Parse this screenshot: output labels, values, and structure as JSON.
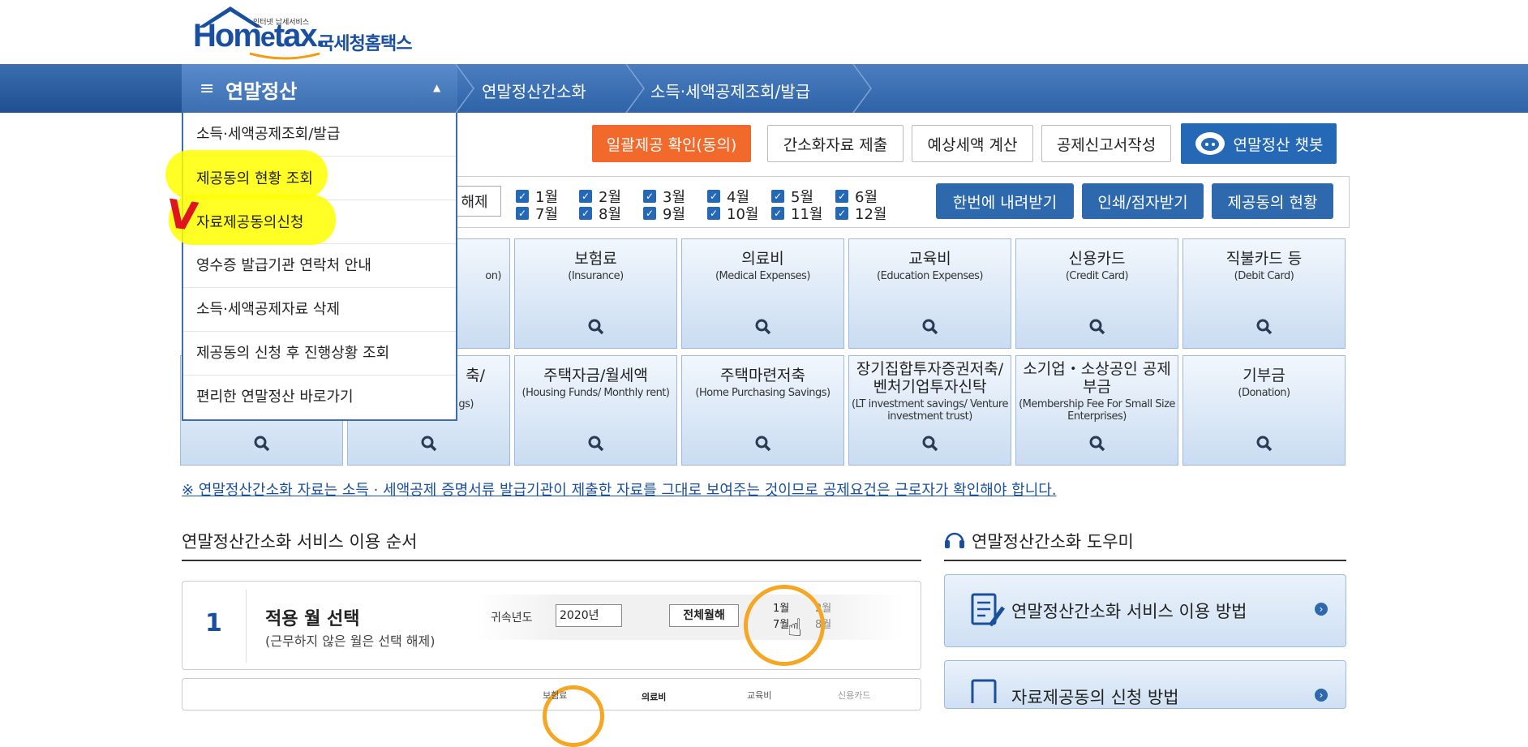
{
  "header": {
    "logo_small": "인터넷 납세서비스",
    "logo_home": "Hom",
    "logo_e": "e",
    "logo_tax": "tax.",
    "logo_kor": "국세청홈택스"
  },
  "nav": {
    "menu_title": "연말정산",
    "breadcrumb": [
      "연말정산간소화",
      "소득·세액공제조회/발급"
    ]
  },
  "dropdown": {
    "items": [
      "소득·세액공제조회/발급",
      "제공동의 현황 조회",
      "자료제공동의신청",
      "영수증 발급기관 연락처 안내",
      "소득·세액공제자료 삭제",
      "제공동의 신청 후 진행상황 조회",
      "편리한 연말정산 바로가기"
    ],
    "checkmark": "V"
  },
  "top_buttons": [
    "일괄제공 확인(동의)",
    "간소화자료 제출",
    "예상세액 계산",
    "공제신고서작성",
    "연말정산 챗봇"
  ],
  "month_bar": {
    "unselect": "해제",
    "months_row1": [
      "1월",
      "2월",
      "3월",
      "4월",
      "5월",
      "6월"
    ],
    "months_row2": [
      "7월",
      "8월",
      "9월",
      "10월",
      "11월",
      "12월"
    ],
    "buttons": [
      "한번에 내려받기",
      "인쇄/점자받기",
      "제공동의 현황"
    ]
  },
  "tiles_row1": [
    {
      "ko": "",
      "en": "on)"
    },
    {
      "ko": "보험료",
      "en": "(Insurance)"
    },
    {
      "ko": "의료비",
      "en": "(Medical Expenses)"
    },
    {
      "ko": "교육비",
      "en": "(Education Expenses)"
    },
    {
      "ko": "신용카드",
      "en": "(Credit Card)"
    },
    {
      "ko": "직불카드 등",
      "en": "(Debit Card)"
    }
  ],
  "tiles_row2": [
    {
      "ko": "",
      "en": ""
    },
    {
      "ko": "축/",
      "en": "gs)"
    },
    {
      "ko": "주택자금/월세액",
      "en": "(Housing Funds/ Monthly rent)"
    },
    {
      "ko": "주택마련저축",
      "en": "(Home Purchasing Savings)"
    },
    {
      "ko": "장기집합투자증권저축/ 벤처기업투자신탁",
      "en": "(LT investment savings/ Venture investment trust)"
    },
    {
      "ko": "소기업・소상공인 공제부금",
      "en": "(Membership Fee For Small Size Enterprises)"
    },
    {
      "ko": "기부금",
      "en": "(Donation)"
    }
  ],
  "notice": "※ 연말정산간소화 자료는 소득 · 세액공제 증명서류 발급기관이 제출한 자료를 그대로 보여주는 것이므로 공제요건은 근로자가 확인해야 합니다.",
  "order_section": {
    "title": "연말정산간소화 서비스 이용 순서",
    "step1_num": "1",
    "step1_title": "적용 월 선택",
    "step1_desc": "(근무하지 않은 월은 선택 해제)",
    "step1_img": {
      "label": "귀속년도",
      "year": "2020년",
      "btn": "전체월해",
      "m1": "1월",
      "m7": "7월",
      "m2": "2월",
      "m8": "8월"
    },
    "step2_img": [
      "보험료",
      "의료비",
      "교육비",
      "신용카드"
    ]
  },
  "help_section": {
    "title": "연말정산간소화 도우미",
    "items": [
      "연말정산간소화 서비스 이용 방법",
      "자료제공동의 신청 방법"
    ]
  }
}
